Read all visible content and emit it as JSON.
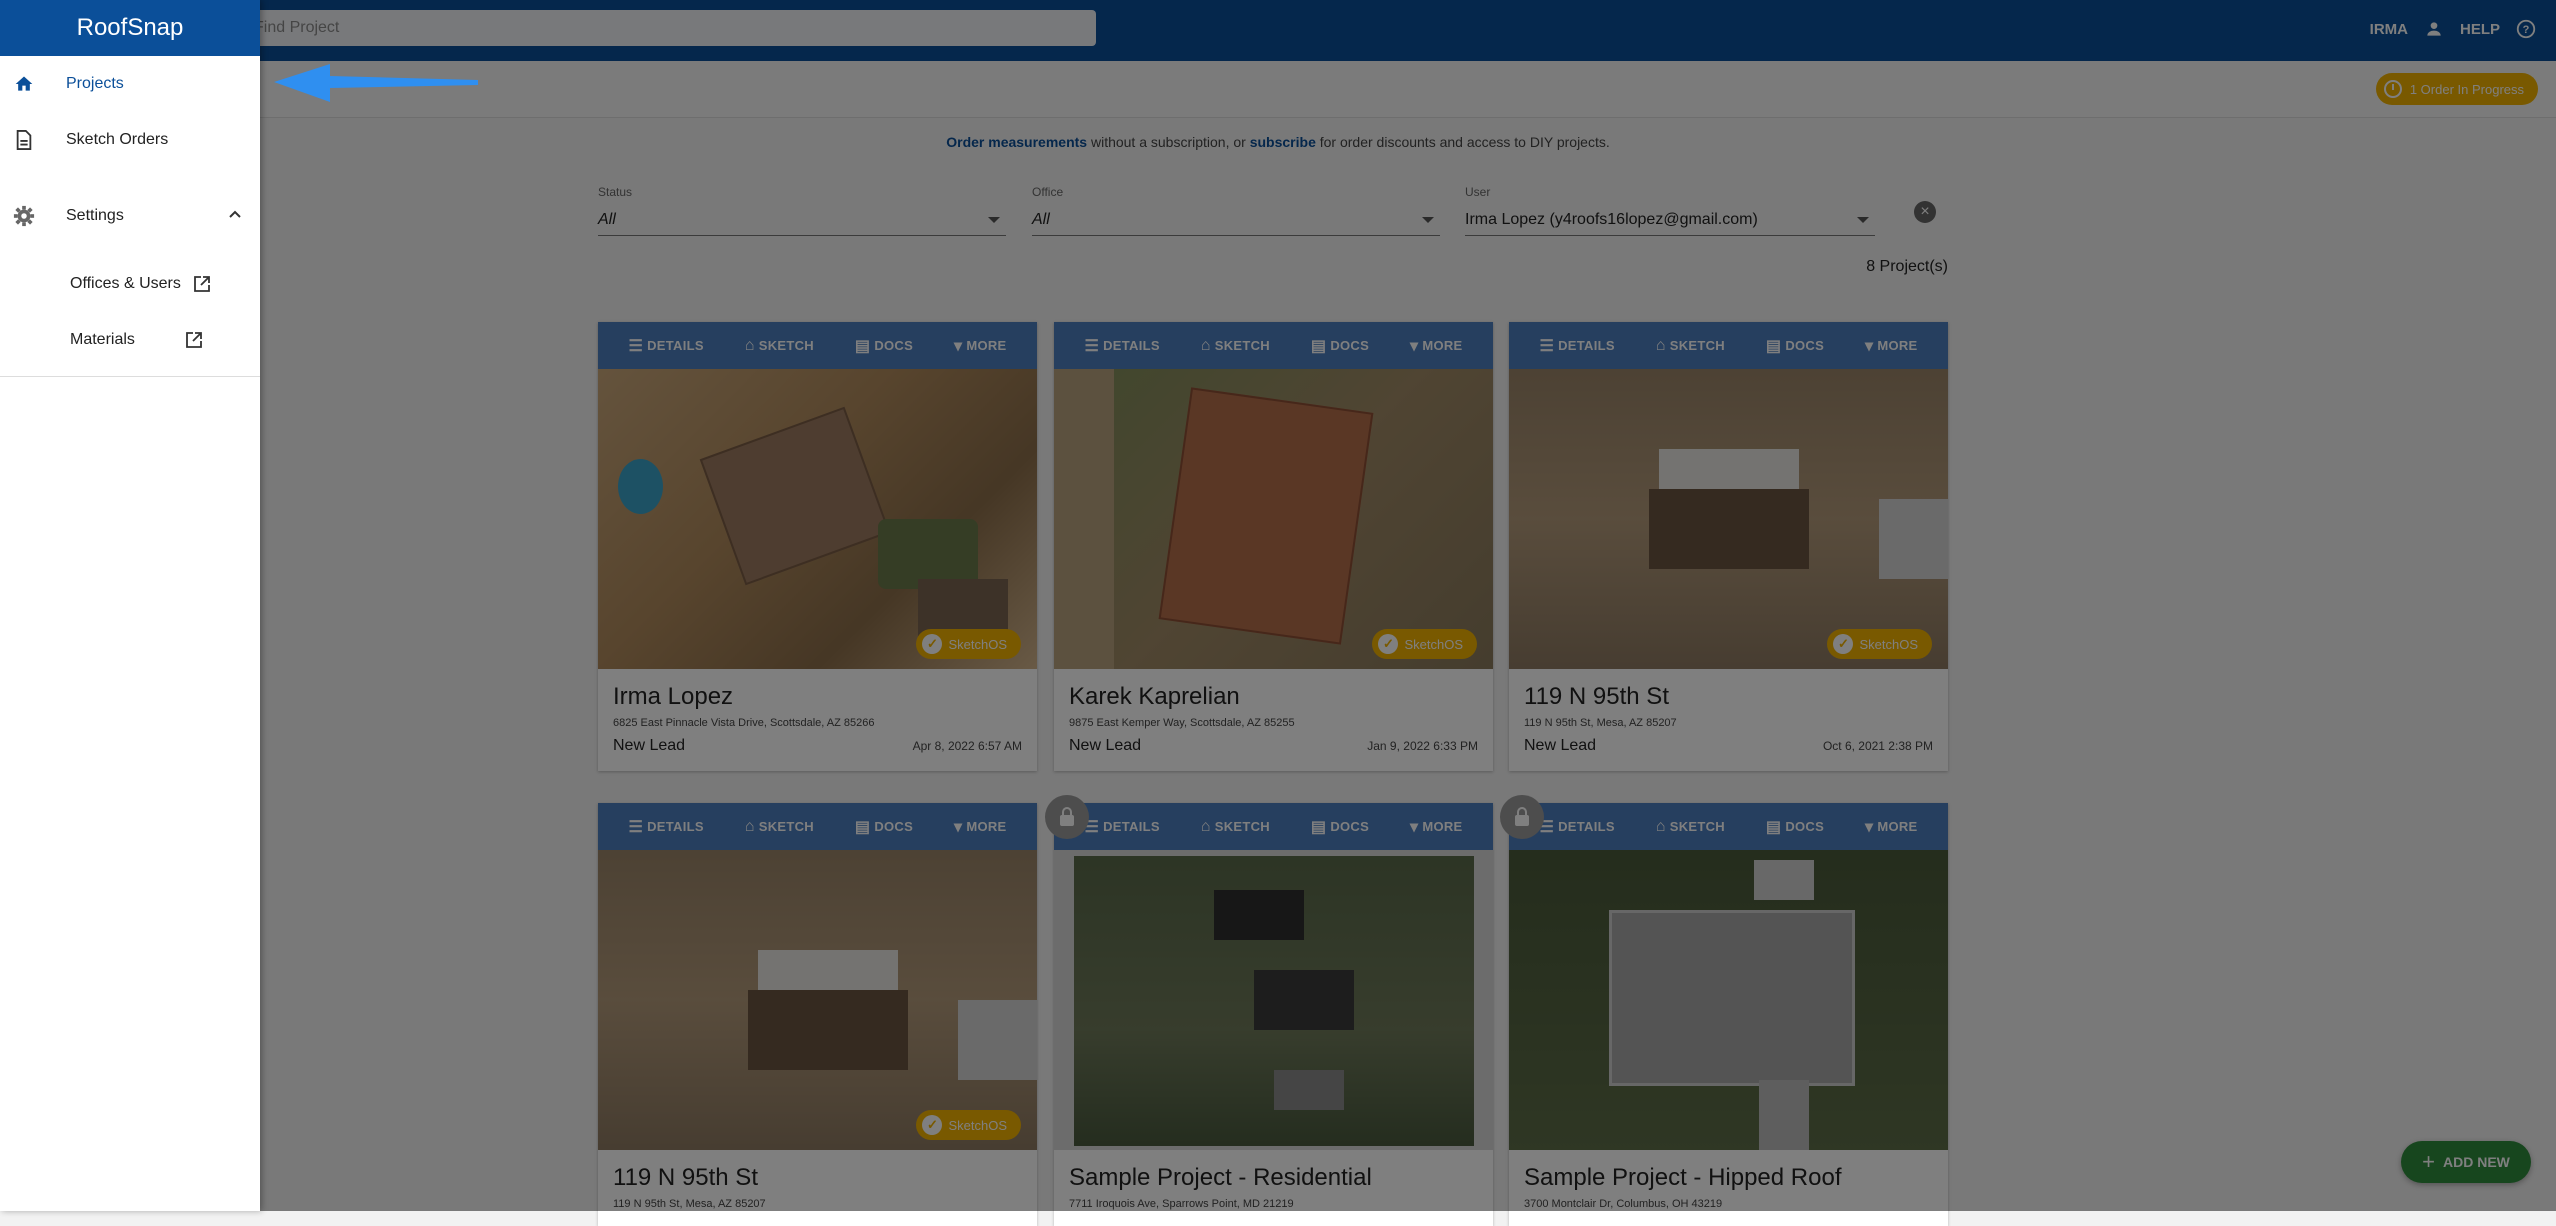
{
  "app": {
    "name": "RoofSnap"
  },
  "topbar": {
    "search_placeholder": "Find Project",
    "user_label": "IRMA",
    "help_label": "HELP"
  },
  "subbar": {
    "order_chip": "1 Order In Progress"
  },
  "banner": {
    "link1": "Order measurements",
    "text1": " without a subscription, or ",
    "link2": "subscribe",
    "text2": " for order discounts and access to DIY projects."
  },
  "filters": {
    "status": {
      "label": "Status",
      "value": "All"
    },
    "office": {
      "label": "Office",
      "value": "All"
    },
    "user": {
      "label": "User",
      "value": "Irma Lopez (y4roofs16lopez@gmail.com)"
    }
  },
  "project_count": "8 Project(s)",
  "toolbar_labels": {
    "details": "DETAILS",
    "sketch": "SKETCH",
    "docs": "DOCS",
    "more": "MORE"
  },
  "badge_label": "SketchOS",
  "projects": [
    {
      "title": "Irma Lopez",
      "address": "6825 East Pinnacle Vista Drive, Scottsdale, AZ 85266",
      "status": "New Lead",
      "date": "Apr 8, 2022 6:57 AM"
    },
    {
      "title": "Karek Kaprelian",
      "address": "9875 East Kemper Way, Scottsdale, AZ 85255",
      "status": "New Lead",
      "date": "Jan 9, 2022 6:33 PM"
    },
    {
      "title": "119 N 95th St",
      "address": "119 N 95th St, Mesa, AZ 85207",
      "status": "New Lead",
      "date": "Oct 6, 2021 2:38 PM"
    },
    {
      "title": "119 N 95th St",
      "address": "119 N 95th St, Mesa, AZ 85207",
      "status": "",
      "date": ""
    },
    {
      "title": "Sample Project - Residential",
      "address": "7711 Iroquois Ave, Sparrows Point, MD 21219",
      "status": "",
      "date": ""
    },
    {
      "title": "Sample Project - Hipped Roof",
      "address": "3700 Montclair Dr, Columbus, OH 43219",
      "status": "",
      "date": ""
    }
  ],
  "fab_label": "ADD NEW",
  "drawer": {
    "title": "RoofSnap",
    "items": [
      {
        "label": "Projects",
        "icon": "home-icon"
      },
      {
        "label": "Sketch Orders",
        "icon": "document-icon"
      },
      {
        "label": "Settings",
        "icon": "gear-icon"
      },
      {
        "label": "Offices & Users",
        "icon": "open-in-new-icon"
      },
      {
        "label": "Materials",
        "icon": "open-in-new-icon"
      }
    ]
  },
  "colors": {
    "brand_blue": "#0b4f99",
    "toolbar_blue": "#4d7fbf",
    "badge_amber": "#f2b300",
    "fab_green": "#2f8c3c",
    "annotation_arrow": "#2f8ff0"
  }
}
